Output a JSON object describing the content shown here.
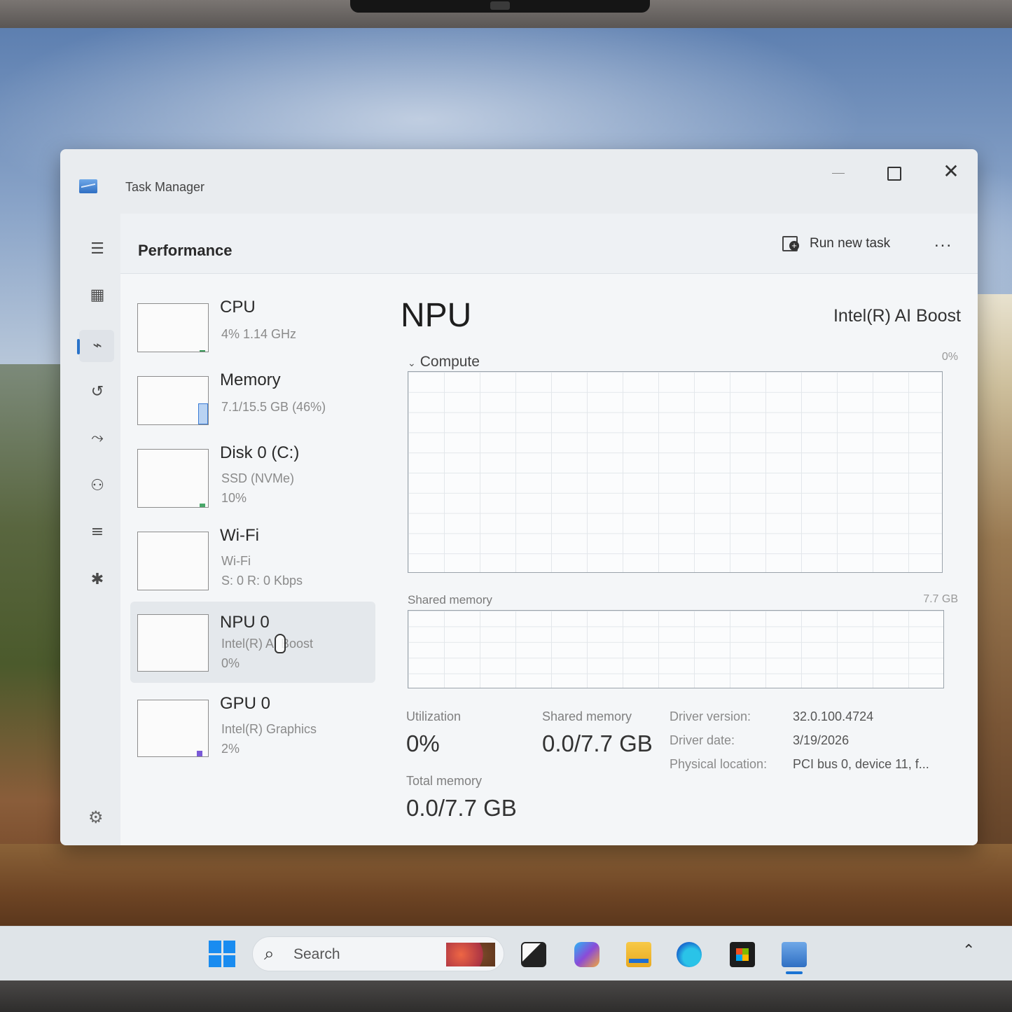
{
  "window": {
    "title": "Task Manager"
  },
  "header": {
    "title": "Performance",
    "run_new_task": "Run new task",
    "more_label": "..."
  },
  "devices": [
    {
      "name": "CPU",
      "line1": "4%  1.14 GHz",
      "line2": ""
    },
    {
      "name": "Memory",
      "line1": "7.1/15.5 GB (46%)",
      "line2": ""
    },
    {
      "name": "Disk 0 (C:)",
      "line1": "SSD (NVMe)",
      "line2": "10%"
    },
    {
      "name": "Wi-Fi",
      "line1": "Wi-Fi",
      "line2": "S: 0  R: 0 Kbps"
    },
    {
      "name": "NPU 0",
      "line1": "Intel(R) AI Boost",
      "line2": "0%"
    },
    {
      "name": "GPU 0",
      "line1": "Intel(R) Graphics",
      "line2": "2%"
    }
  ],
  "selected_device": "NPU 0",
  "detail": {
    "title": "NPU",
    "model": "Intel(R) AI Boost",
    "compute_label": "Compute",
    "compute_pct": "0%",
    "shared_memory_label": "Shared memory",
    "shared_memory_max": "7.7 GB",
    "utilization_label": "Utilization",
    "utilization_value": "0%",
    "shared_memory_stat_label": "Shared memory",
    "shared_memory_stat_value": "0.0/7.7 GB",
    "total_memory_label": "Total memory",
    "total_memory_value": "0.0/7.7 GB",
    "info": [
      {
        "key": "Driver version:",
        "value": "32.0.100.4724"
      },
      {
        "key": "Driver date:",
        "value": "3/19/2026"
      },
      {
        "key": "Physical location:",
        "value": "PCI bus 0, device 11, f..."
      }
    ]
  },
  "taskbar": {
    "search_placeholder": "Search"
  },
  "accent_color": "#2a73c9"
}
